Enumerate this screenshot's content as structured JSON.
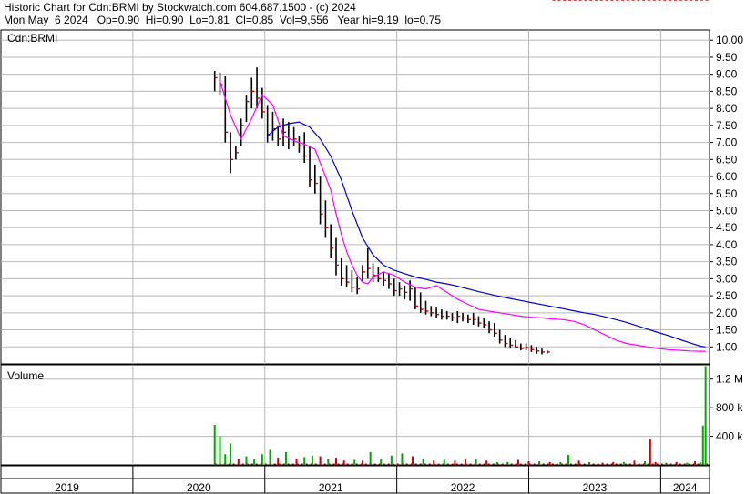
{
  "header": {
    "line1": "Historic Chart for Cdn:BRMI by Stockwatch.com 604.687.1500 - (c) 2024",
    "line2": "Mon May  6 2024   Op=0.90  Hi=0.90  Lo=0.81  Cl=0.85  Vol=9,556   Year hi=9.19  lo=0.75"
  },
  "colors": {
    "up_volume": "#00aa00",
    "down_volume": "#cc0000",
    "price_bar": "#000000",
    "close_tick": "#cc0000",
    "ma_short": "#ff00ff",
    "ma_long": "#0000cc",
    "grid": "#b8b8b8",
    "frame": "#000000"
  },
  "chart_data": [
    {
      "type": "line",
      "panel": "price",
      "symbol": "Cdn:BRMI",
      "ylim": [
        0.5,
        10.3
      ],
      "y_ticks": [
        "10.00",
        "9.50",
        "9.00",
        "8.50",
        "8.00",
        "7.50",
        "7.00",
        "6.50",
        "6.00",
        "5.50",
        "5.00",
        "4.50",
        "4.00",
        "3.50",
        "3.00",
        "2.50",
        "2.00",
        "1.50",
        "1.00"
      ],
      "x_ticks": [
        "2019",
        "2020",
        "2021",
        "2022",
        "2023",
        "2024"
      ],
      "year_starts": [
        2019,
        2020,
        2021,
        2022,
        2023,
        2024
      ],
      "x_range": [
        2019.0,
        2024.37
      ],
      "grid": true,
      "series": [
        {
          "role": "price",
          "x": [
            2020.62,
            2020.66,
            2020.7,
            2020.74,
            2020.78,
            2020.82,
            2020.86,
            2020.9,
            2020.94,
            2020.98,
            2021.02,
            2021.06,
            2021.1,
            2021.14,
            2021.18,
            2021.22,
            2021.26,
            2021.3,
            2021.34,
            2021.38,
            2021.42,
            2021.46,
            2021.5,
            2021.54,
            2021.58,
            2021.62,
            2021.66,
            2021.7,
            2021.74,
            2021.78,
            2021.82,
            2021.86,
            2021.9,
            2021.94,
            2021.98,
            2022.02,
            2022.06,
            2022.1,
            2022.14,
            2022.18,
            2022.22,
            2022.26,
            2022.3,
            2022.34,
            2022.38,
            2022.42,
            2022.46,
            2022.5,
            2022.54,
            2022.58,
            2022.62,
            2022.66,
            2022.7,
            2022.74,
            2022.78,
            2022.82,
            2022.86,
            2022.9,
            2022.94,
            2022.98,
            2023.02,
            2023.06,
            2023.1,
            2023.14,
            2023.18,
            2023.22,
            2023.26,
            2023.3,
            2023.34,
            2023.38,
            2023.42,
            2023.46,
            2023.5,
            2023.54,
            2023.58,
            2023.62,
            2023.66,
            2023.7,
            2023.74,
            2023.78,
            2023.82,
            2023.86,
            2023.9,
            2023.94,
            2023.98,
            2024.02,
            2024.06,
            2024.1,
            2024.14,
            2024.18,
            2024.22,
            2024.26,
            2024.3,
            2024.34
          ],
          "high": [
            9.1,
            9.05,
            8.95,
            7.3,
            6.9,
            7.7,
            8.4,
            8.9,
            9.2,
            8.6,
            8.1,
            7.9,
            7.5,
            7.7,
            7.6,
            7.45,
            7.2,
            7.3,
            6.9,
            6.35,
            6.0,
            5.3,
            4.6,
            4.2,
            3.6,
            3.4,
            3.25,
            3.05,
            3.4,
            3.9,
            3.45,
            3.35,
            3.2,
            3.15,
            3.0,
            2.9,
            2.8,
            2.95,
            2.75,
            2.6,
            2.35,
            2.2,
            2.15,
            2.1,
            2.05,
            2.0,
            2.05,
            2.0,
            1.95,
            2.0,
            1.9,
            1.85,
            1.75,
            1.7,
            1.5,
            1.35,
            1.25,
            1.2,
            1.1,
            1.1,
            1.05,
            1.0,
            0.95,
            0.9
          ],
          "low": [
            8.5,
            8.4,
            7.0,
            6.1,
            6.5,
            6.9,
            7.6,
            8.0,
            8.0,
            7.7,
            7.0,
            7.05,
            6.9,
            6.9,
            6.8,
            6.9,
            6.7,
            6.4,
            5.7,
            5.5,
            4.6,
            4.2,
            3.6,
            3.1,
            2.8,
            2.75,
            2.6,
            2.55,
            2.9,
            3.0,
            2.9,
            2.9,
            2.8,
            2.7,
            2.5,
            2.5,
            2.4,
            2.35,
            2.1,
            2.0,
            1.95,
            1.9,
            1.85,
            1.8,
            1.8,
            1.75,
            1.7,
            1.75,
            1.7,
            1.65,
            1.6,
            1.55,
            1.4,
            1.3,
            1.1,
            1.0,
            0.95,
            0.95,
            0.9,
            0.9,
            0.85,
            0.8,
            0.78,
            0.8
          ],
          "close": [
            8.9,
            8.7,
            7.3,
            6.5,
            6.7,
            7.5,
            8.2,
            8.5,
            8.3,
            7.9,
            7.2,
            7.4,
            7.1,
            7.3,
            7.1,
            7.1,
            6.9,
            6.6,
            5.9,
            5.8,
            4.9,
            4.5,
            3.9,
            3.4,
            3.0,
            2.9,
            2.75,
            2.7,
            3.2,
            3.3,
            3.1,
            3.0,
            2.95,
            2.85,
            2.65,
            2.7,
            2.6,
            2.7,
            2.2,
            2.1,
            2.05,
            2.0,
            1.95,
            1.9,
            1.9,
            1.85,
            1.9,
            1.85,
            1.8,
            1.8,
            1.7,
            1.65,
            1.5,
            1.4,
            1.2,
            1.1,
            1.05,
            1.0,
            0.95,
            0.98,
            0.92,
            0.88,
            0.85,
            0.85
          ]
        },
        {
          "role": "ma_short",
          "x": [
            2020.66,
            2020.74,
            2020.82,
            2020.9,
            2020.98,
            2021.06,
            2021.14,
            2021.22,
            2021.3,
            2021.38,
            2021.46,
            2021.5,
            2021.54,
            2021.58,
            2021.62,
            2021.66,
            2021.7,
            2021.74,
            2021.78,
            2021.82,
            2021.9,
            2021.98,
            2022.06,
            2022.14,
            2022.22,
            2022.3,
            2022.38,
            2022.46,
            2022.54,
            2022.62,
            2022.7,
            2022.78,
            2022.86,
            2022.94,
            2023.02,
            2023.1,
            2023.18,
            2023.26,
            2023.34,
            2023.42,
            2023.5,
            2023.58,
            2023.66,
            2023.74,
            2023.82,
            2023.9,
            2023.98,
            2024.06,
            2024.14,
            2024.22,
            2024.3,
            2024.34
          ],
          "values": [
            8.8,
            7.8,
            7.1,
            7.7,
            8.4,
            8.1,
            7.2,
            7.05,
            6.95,
            6.8,
            6.0,
            5.6,
            4.9,
            4.3,
            3.8,
            3.4,
            3.1,
            2.9,
            2.85,
            3.05,
            3.2,
            3.1,
            2.9,
            2.75,
            2.7,
            2.8,
            2.6,
            2.4,
            2.25,
            2.1,
            2.05,
            2.0,
            1.95,
            1.9,
            1.87,
            1.85,
            1.82,
            1.8,
            1.75,
            1.65,
            1.5,
            1.35,
            1.2,
            1.1,
            1.05,
            1.0,
            0.95,
            0.92,
            0.9,
            0.88,
            0.87,
            0.87
          ]
        },
        {
          "role": "ma_long",
          "x": [
            2021.02,
            2021.1,
            2021.18,
            2021.26,
            2021.34,
            2021.42,
            2021.5,
            2021.58,
            2021.66,
            2021.74,
            2021.82,
            2021.9,
            2021.98,
            2022.06,
            2022.14,
            2022.22,
            2022.3,
            2022.38,
            2022.46,
            2022.54,
            2022.62,
            2022.7,
            2022.78,
            2022.86,
            2022.94,
            2023.02,
            2023.1,
            2023.18,
            2023.26,
            2023.34,
            2023.42,
            2023.5,
            2023.58,
            2023.66,
            2023.74,
            2023.82,
            2023.9,
            2023.98,
            2024.06,
            2024.14,
            2024.22,
            2024.3,
            2024.34
          ],
          "values": [
            7.2,
            7.45,
            7.55,
            7.6,
            7.45,
            7.1,
            6.6,
            5.9,
            5.0,
            4.2,
            3.7,
            3.4,
            3.25,
            3.15,
            3.05,
            2.98,
            2.9,
            2.85,
            2.78,
            2.7,
            2.62,
            2.55,
            2.48,
            2.42,
            2.36,
            2.3,
            2.24,
            2.18,
            2.12,
            2.06,
            2.0,
            1.95,
            1.88,
            1.8,
            1.72,
            1.62,
            1.52,
            1.42,
            1.33,
            1.22,
            1.12,
            1.02,
            1.0
          ]
        }
      ]
    },
    {
      "type": "bar",
      "panel": "volume",
      "label": "Volume",
      "ylim": [
        0,
        1400000
      ],
      "y_ticks": [
        "1.2 M",
        "800 k",
        "400 k"
      ],
      "x": [
        2020.62,
        2020.66,
        2020.7,
        2020.74,
        2020.8,
        2020.86,
        2020.92,
        2020.98,
        2021.04,
        2021.1,
        2021.16,
        2021.24,
        2021.3,
        2021.36,
        2021.42,
        2021.48,
        2021.54,
        2021.6,
        2021.68,
        2021.74,
        2021.8,
        2021.88,
        2021.96,
        2022.04,
        2022.12,
        2022.2,
        2022.28,
        2022.36,
        2022.44,
        2022.52,
        2022.6,
        2022.68,
        2022.76,
        2022.84,
        2022.92,
        2023.0,
        2023.08,
        2023.16,
        2023.24,
        2023.3,
        2023.38,
        2023.46,
        2023.56,
        2023.64,
        2023.72,
        2023.8,
        2023.88,
        2023.92,
        2023.96,
        2024.04,
        2024.12,
        2024.2,
        2024.26,
        2024.3,
        2024.32,
        2024.34
      ],
      "values": [
        560000,
        400000,
        150000,
        300000,
        90000,
        120000,
        80000,
        150000,
        210000,
        100000,
        180000,
        90000,
        110000,
        130000,
        120000,
        80000,
        100000,
        60000,
        70000,
        60000,
        180000,
        80000,
        130000,
        160000,
        120000,
        90000,
        60000,
        70000,
        60000,
        90000,
        80000,
        60000,
        40000,
        40000,
        70000,
        50000,
        50000,
        40000,
        40000,
        140000,
        60000,
        40000,
        30000,
        40000,
        40000,
        60000,
        50000,
        360000,
        40000,
        30000,
        40000,
        30000,
        50000,
        40000,
        550000,
        1380000
      ],
      "up": [
        true,
        true,
        true,
        true,
        false,
        true,
        true,
        true,
        true,
        false,
        true,
        false,
        true,
        true,
        false,
        true,
        false,
        false,
        true,
        false,
        true,
        true,
        true,
        true,
        false,
        true,
        false,
        true,
        false,
        false,
        true,
        false,
        true,
        true,
        false,
        false,
        true,
        false,
        true,
        true,
        false,
        true,
        false,
        false,
        true,
        false,
        true,
        false,
        false,
        true,
        false,
        true,
        false,
        true,
        true,
        true
      ]
    }
  ]
}
